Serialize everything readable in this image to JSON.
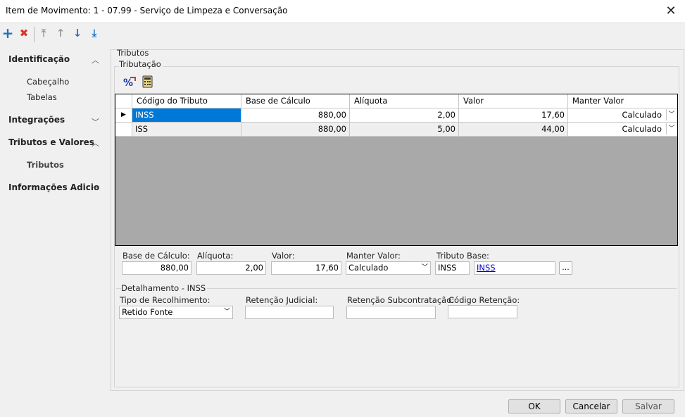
{
  "window": {
    "title": "Item de Movimento: 1 - 07.99 - Serviço de Limpeza e Conversação",
    "close": "✕"
  },
  "toolbar": {
    "add": "+",
    "delete": "✖",
    "first": "⤒",
    "up": "↑",
    "down": "↓",
    "last": "⤓"
  },
  "nav": {
    "sections": [
      {
        "label": "Identificação",
        "chevron": "︿"
      },
      {
        "label": "Integrações",
        "chevron": "﹀"
      },
      {
        "label": "Tributos e Valores",
        "chevron": "︿"
      },
      {
        "label": "Informações Adicio",
        "chevron": "﹀"
      }
    ],
    "sub": {
      "cabecalho": "Cabeçalho",
      "tabelas": "Tabelas",
      "tributos": "Tributos"
    }
  },
  "panel": {
    "title": "Tributos",
    "subtitle": "Tributação"
  },
  "grid": {
    "headers": [
      "Código do Tributo",
      "Base de Cálculo",
      "Alíquota",
      "Valor",
      "Manter Valor"
    ],
    "rows": [
      {
        "codigo": "INSS",
        "base": "880,00",
        "aliquota": "2,00",
        "valor": "17,60",
        "manter": "Calculado"
      },
      {
        "codigo": "ISS",
        "base": "880,00",
        "aliquota": "5,00",
        "valor": "44,00",
        "manter": "Calculado"
      }
    ],
    "row_indicator": "▶"
  },
  "form": {
    "base_label": "Base de Cálculo:",
    "base": "880,00",
    "aliquota_label": "Alíquota:",
    "aliquota": "2,00",
    "valor_label": "Valor:",
    "valor": "17,60",
    "manter_label": "Manter Valor:",
    "manter": "Calculado",
    "tributo_label": "Tributo Base:",
    "tributo_code": "INSS",
    "tributo_link": "INSS",
    "ellipsis": "..."
  },
  "detalhe": {
    "title": "Detalhamento - INSS",
    "tipo_label": "Tipo de Recolhimento:",
    "tipo": "Retido Fonte",
    "judicial_label": "Retenção Judicial:",
    "judicial": "",
    "subcontr_label": "Retenção Subcontratação:",
    "subcontr": "",
    "codigo_label": "Código Retenção:",
    "codigo": ""
  },
  "buttons": {
    "ok": "OK",
    "cancel": "Cancelar",
    "save": "Salvar"
  },
  "colors": {
    "selection": "#0078d7",
    "link": "#0000cc",
    "accent_add": "#1e73be",
    "accent_delete": "#d9342b"
  }
}
